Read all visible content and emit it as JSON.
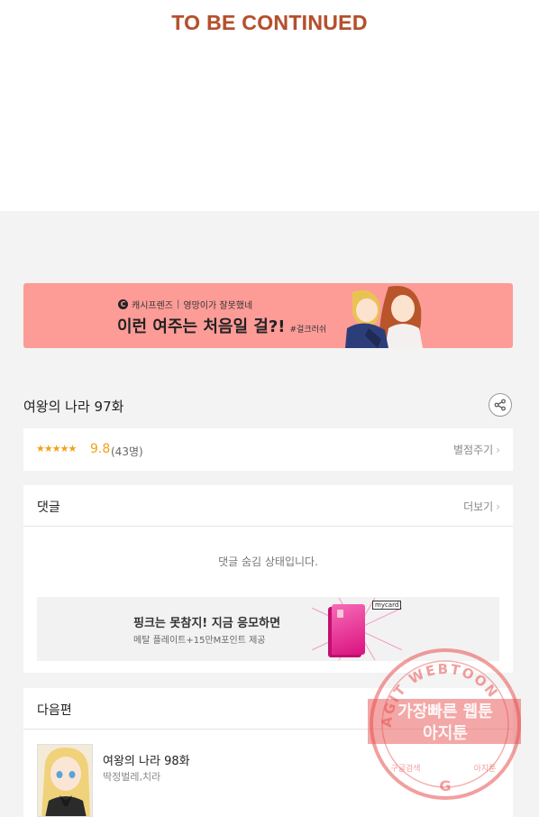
{
  "header": {
    "to_be_continued": "TO BE CONTINUED"
  },
  "banner": {
    "logo_letter": "C",
    "publisher": "캐시프렌즈",
    "divider": "|",
    "series": "영망이가 잘못했네",
    "headline": "이런 여주는 처음일 걸?!",
    "hashtag": "#걸크러쉬"
  },
  "episode": {
    "title": "여왕의 나라 97화",
    "share_icon": "share-icon"
  },
  "rating": {
    "stars": "★★★★★",
    "score": "9.8",
    "count": "(43명)",
    "rate_label": "별점주기",
    "chevron": "›"
  },
  "comments": {
    "title": "댓글",
    "more_label": "더보기",
    "chevron": "›",
    "hidden_message": "댓글 숨김 상태입니다."
  },
  "ad": {
    "title": "핑크는 못참지! 지금 응모하면",
    "subtitle": "메탈 플레이트+15만M포인트 제공",
    "card_logo": "mycard"
  },
  "next": {
    "title": "다음편",
    "episode_title": "여왕의 나라 98화",
    "authors": "딱정벌레,치라"
  },
  "watermark": {
    "ring_text": "AGIT WEBTOON",
    "line1": "가장빠른 웹툰",
    "line2": "아지툰",
    "left_small": "구글검색",
    "right_small": "아지툰",
    "g_letter": "G"
  },
  "colors": {
    "accent": "#b4502d",
    "banner_bg": "#fd9b97",
    "star": "#f0a217",
    "watermark": "#e85050"
  }
}
